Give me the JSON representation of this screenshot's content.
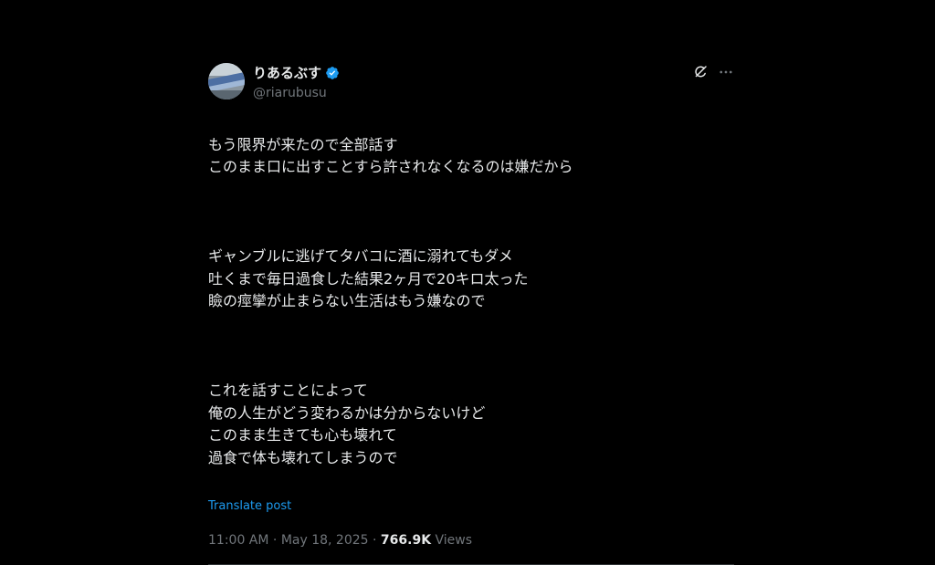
{
  "author": {
    "display_name": "りあるぶす",
    "handle": "@riarubusu",
    "verified": true
  },
  "post": {
    "paragraphs": [
      "もう限界が来たので全部話す\nこのまま口に出すことすら許されなくなるのは嫌だから",
      "ギャンブルに逃げてタバコに酒に溺れてもダメ\n吐くまで毎日過食した結果2ヶ月で20キロ太った\n瞼の痙攣が止まらない生活はもう嫌なので",
      "これを話すことによって\n俺の人生がどう変わるかは分からないけど\nこのまま生きても心も壊れて\n過食で体も壊れてしまうので"
    ],
    "translate_label": "Translate post"
  },
  "meta": {
    "time": "11:00 AM",
    "separator": " · ",
    "date": "May 18, 2025",
    "views_count": "766.9K",
    "views_label": " Views"
  },
  "icons": {
    "verified": "verified-badge-icon",
    "grok": "grok-icon",
    "more": "more-icon"
  },
  "colors": {
    "accent": "#1d9bf0",
    "background": "#000000",
    "text": "#e7e9ea",
    "secondary": "#71767b"
  }
}
